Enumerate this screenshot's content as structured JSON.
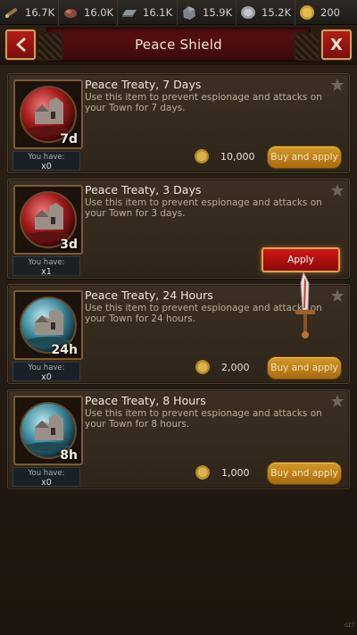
{
  "resources": [
    {
      "icon": "wood-icon",
      "value": "16.7K"
    },
    {
      "icon": "food-icon",
      "value": "16.0K"
    },
    {
      "icon": "iron-icon",
      "value": "16.1K"
    },
    {
      "icon": "stone-icon",
      "value": "15.9K"
    },
    {
      "icon": "silver-icon",
      "value": "15.2K"
    },
    {
      "icon": "gold-icon",
      "value": "200"
    }
  ],
  "header": {
    "title": "Peace Shield",
    "back_icon": "chevron-left-icon",
    "close_label": "X"
  },
  "items": [
    {
      "title": "Peace Treaty, 7 Days",
      "desc": "Use this item to prevent espionage and attacks on your Town for 7 days.",
      "duration": "7d",
      "have_label": "You have:",
      "have": "x0",
      "price": "10,000",
      "action": "Buy and apply",
      "orb": "red"
    },
    {
      "title": "Peace Treaty, 3 Days",
      "desc": "Use this item to prevent espionage and attacks on your Town for 3 days.",
      "duration": "3d",
      "have_label": "You have:",
      "have": "x1",
      "action": "Apply",
      "orb": "red"
    },
    {
      "title": "Peace Treaty, 24 Hours",
      "desc": "Use this item to prevent espionage and attacks on your Town for 24 hours.",
      "duration": "24h",
      "have_label": "You have:",
      "have": "x0",
      "price": "2,000",
      "action": "Buy and apply",
      "orb": "blue"
    },
    {
      "title": "Peace Treaty, 8 Hours",
      "desc": "Use this item to prevent espionage and attacks on your Town for 8 hours.",
      "duration": "8h",
      "have_label": "You have:",
      "have": "x0",
      "price": "1,000",
      "action": "Buy and apply",
      "orb": "blue"
    }
  ],
  "colors": {
    "accent_red": "#b51c18",
    "gold": "#d49a28",
    "panel": "#3a2f22"
  },
  "corner_tag": "GIT"
}
